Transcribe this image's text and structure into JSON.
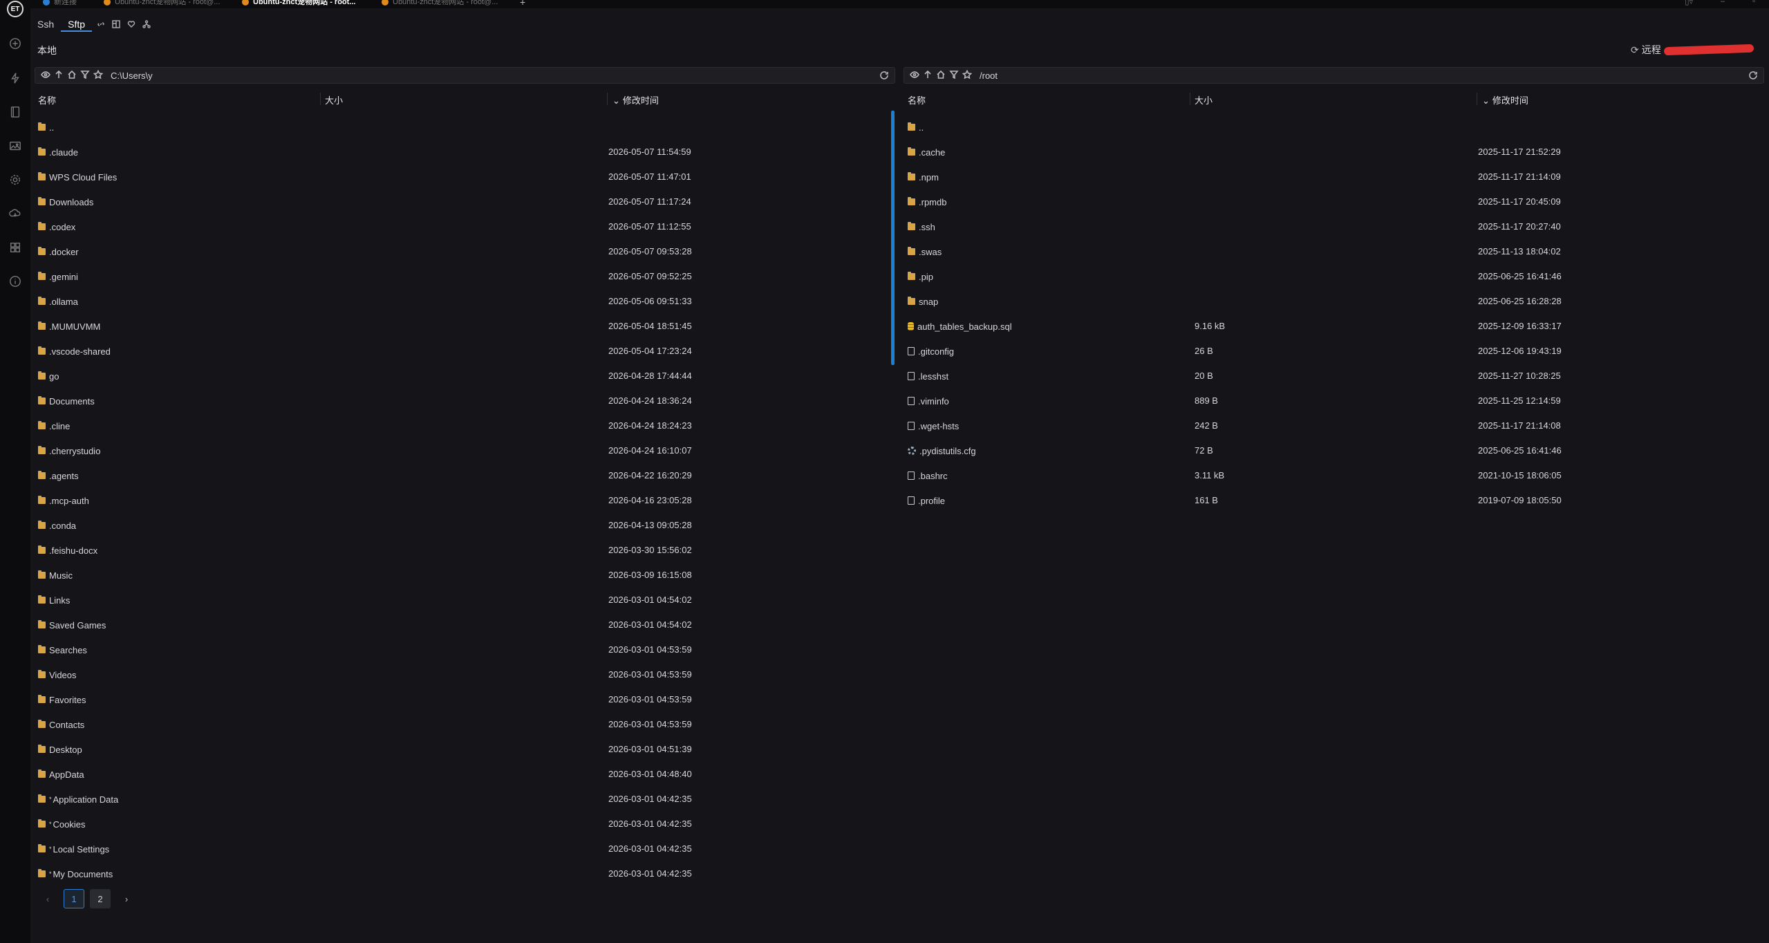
{
  "tabs": [
    {
      "label": "新连接",
      "color": "#2a7fd4"
    },
    {
      "label": "Ubuntu-znct宠物网站 - root@...",
      "color": "#e08a1a"
    },
    {
      "label": "Ubuntu-znct宠物网站 - root...",
      "color": "#e08a1a",
      "active": true
    },
    {
      "label": "Ubuntu-znct宠物网站 - root@...",
      "color": "#e08a1a"
    }
  ],
  "new_tab_label": "+",
  "logo_text": "ET",
  "modes": {
    "ssh": "Ssh",
    "sftp": "Sftp"
  },
  "local": {
    "caption": "本地",
    "path": "C:\\Users\\y",
    "columns": {
      "name": "名称",
      "size": "大小",
      "mtime": "修改时间"
    },
    "rows": [
      {
        "name": "..",
        "type": "folder",
        "mtime": ""
      },
      {
        "name": ".claude",
        "type": "folder",
        "mtime": "2026-05-07 11:54:59"
      },
      {
        "name": "WPS Cloud Files",
        "type": "folder",
        "mtime": "2026-05-07 11:47:01"
      },
      {
        "name": "Downloads",
        "type": "folder",
        "mtime": "2026-05-07 11:17:24"
      },
      {
        "name": ".codex",
        "type": "folder",
        "mtime": "2026-05-07 11:12:55"
      },
      {
        "name": ".docker",
        "type": "folder",
        "mtime": "2026-05-07 09:53:28"
      },
      {
        "name": ".gemini",
        "type": "folder",
        "mtime": "2026-05-07 09:52:25"
      },
      {
        "name": ".ollama",
        "type": "folder",
        "mtime": "2026-05-06 09:51:33"
      },
      {
        "name": ".MUMUVMM",
        "type": "folder",
        "mtime": "2026-05-04 18:51:45"
      },
      {
        "name": ".vscode-shared",
        "type": "folder",
        "mtime": "2026-05-04 17:23:24"
      },
      {
        "name": "go",
        "type": "folder",
        "mtime": "2026-04-28 17:44:44"
      },
      {
        "name": "Documents",
        "type": "folder",
        "mtime": "2026-04-24 18:36:24"
      },
      {
        "name": ".cline",
        "type": "folder",
        "mtime": "2026-04-24 18:24:23"
      },
      {
        "name": ".cherrystudio",
        "type": "folder",
        "mtime": "2026-04-24 16:10:07"
      },
      {
        "name": ".agents",
        "type": "folder",
        "mtime": "2026-04-22 16:20:29"
      },
      {
        "name": ".mcp-auth",
        "type": "folder",
        "mtime": "2026-04-16 23:05:28"
      },
      {
        "name": ".conda",
        "type": "folder",
        "mtime": "2026-04-13 09:05:28"
      },
      {
        "name": ".feishu-docx",
        "type": "folder",
        "mtime": "2026-03-30 15:56:02"
      },
      {
        "name": "Music",
        "type": "folder",
        "mtime": "2026-03-09 16:15:08"
      },
      {
        "name": "Links",
        "type": "folder",
        "mtime": "2026-03-01 04:54:02"
      },
      {
        "name": "Saved Games",
        "type": "folder",
        "mtime": "2026-03-01 04:54:02"
      },
      {
        "name": "Searches",
        "type": "folder",
        "mtime": "2026-03-01 04:53:59"
      },
      {
        "name": "Videos",
        "type": "folder",
        "mtime": "2026-03-01 04:53:59"
      },
      {
        "name": "Favorites",
        "type": "folder",
        "mtime": "2026-03-01 04:53:59"
      },
      {
        "name": "Contacts",
        "type": "folder",
        "mtime": "2026-03-01 04:53:59"
      },
      {
        "name": "Desktop",
        "type": "folder",
        "mtime": "2026-03-01 04:51:39"
      },
      {
        "name": "AppData",
        "type": "folder",
        "mtime": "2026-03-01 04:48:40"
      },
      {
        "name": "Application Data",
        "type": "folder",
        "link": "*",
        "mtime": "2026-03-01 04:42:35"
      },
      {
        "name": "Cookies",
        "type": "folder",
        "link": "*",
        "mtime": "2026-03-01 04:42:35"
      },
      {
        "name": "Local Settings",
        "type": "folder",
        "link": "*",
        "mtime": "2026-03-01 04:42:35"
      },
      {
        "name": "My Documents",
        "type": "folder",
        "link": "*",
        "mtime": "2026-03-01 04:42:35"
      }
    ],
    "pagination": {
      "prev": "‹",
      "pages": [
        "1",
        "2"
      ],
      "current": "1",
      "next": "›"
    }
  },
  "remote": {
    "caption": "远程",
    "path": "/root",
    "columns": {
      "name": "名称",
      "size": "大小",
      "mtime": "修改时间"
    },
    "rows": [
      {
        "name": "..",
        "type": "folder",
        "size": "",
        "mtime": ""
      },
      {
        "name": ".cache",
        "type": "folder",
        "size": "",
        "mtime": "2025-11-17 21:52:29"
      },
      {
        "name": ".npm",
        "type": "folder",
        "size": "",
        "mtime": "2025-11-17 21:14:09"
      },
      {
        "name": ".rpmdb",
        "type": "folder",
        "size": "",
        "mtime": "2025-11-17 20:45:09"
      },
      {
        "name": ".ssh",
        "type": "folder",
        "size": "",
        "mtime": "2025-11-17 20:27:40"
      },
      {
        "name": ".swas",
        "type": "folder",
        "size": "",
        "mtime": "2025-11-13 18:04:02"
      },
      {
        "name": ".pip",
        "type": "folder",
        "size": "",
        "mtime": "2025-06-25 16:41:46"
      },
      {
        "name": "snap",
        "type": "folder",
        "size": "",
        "mtime": "2025-06-25 16:28:28"
      },
      {
        "name": "auth_tables_backup.sql",
        "type": "db",
        "size": "9.16 kB",
        "mtime": "2025-12-09 16:33:17"
      },
      {
        "name": ".gitconfig",
        "type": "file",
        "size": "26 B",
        "mtime": "2025-12-06 19:43:19"
      },
      {
        "name": ".lesshst",
        "type": "file",
        "size": "20 B",
        "mtime": "2025-11-27 10:28:25"
      },
      {
        "name": ".viminfo",
        "type": "file",
        "size": "889 B",
        "mtime": "2025-11-25 12:14:59"
      },
      {
        "name": ".wget-hsts",
        "type": "file",
        "size": "242 B",
        "mtime": "2025-11-17 21:14:08"
      },
      {
        "name": ".pydistutils.cfg",
        "type": "gear",
        "size": "72 B",
        "mtime": "2025-06-25 16:41:46"
      },
      {
        "name": ".bashrc",
        "type": "file",
        "size": "3.11 kB",
        "mtime": "2021-10-15 18:06:05"
      },
      {
        "name": ".profile",
        "type": "file",
        "size": "161 B",
        "mtime": "2019-07-09 18:05:50"
      }
    ]
  },
  "colors": {
    "accent": "#2f7fd1",
    "folder": "#d9a544",
    "background": "#151519"
  }
}
